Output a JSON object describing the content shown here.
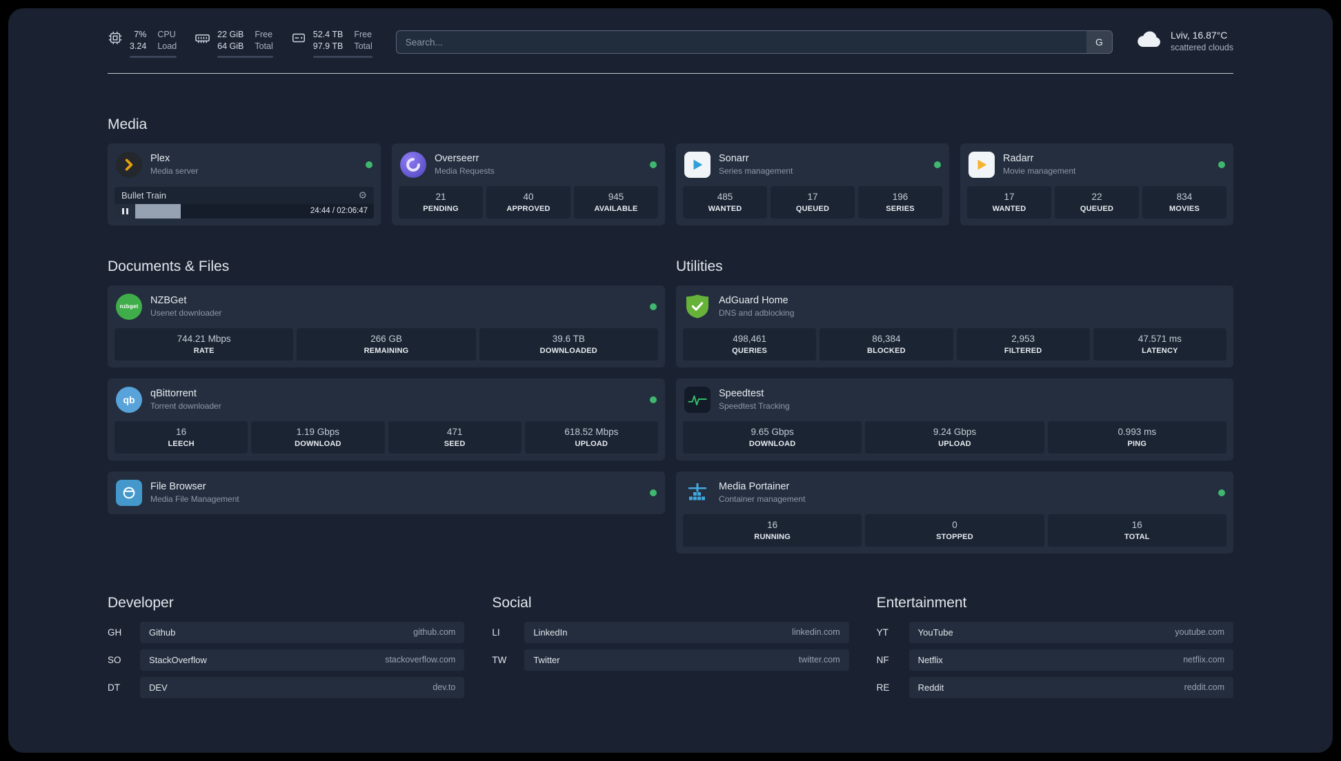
{
  "topbar": {
    "cpu": {
      "value1": "7%",
      "value2": "3.24",
      "label1": "CPU",
      "label2": "Load"
    },
    "ram": {
      "value1": "22 GiB",
      "value2": "64 GiB",
      "label1": "Free",
      "label2": "Total"
    },
    "disk": {
      "value1": "52.4 TB",
      "value2": "97.9 TB",
      "label1": "Free",
      "label2": "Total"
    },
    "search": {
      "placeholder": "Search...",
      "button_label": "G"
    },
    "weather": {
      "location": "Lviv, 16.87°C",
      "condition": "scattered clouds"
    }
  },
  "sections": {
    "media": "Media",
    "documents": "Documents & Files",
    "utilities": "Utilities",
    "developer": "Developer",
    "social": "Social",
    "entertainment": "Entertainment"
  },
  "apps": {
    "plex": {
      "title": "Plex",
      "subtitle": "Media server",
      "now_playing": "Bullet Train",
      "time": "24:44 / 02:06:47"
    },
    "overseerr": {
      "title": "Overseerr",
      "subtitle": "Media Requests",
      "stats": [
        {
          "value": "21",
          "label": "PENDING"
        },
        {
          "value": "40",
          "label": "APPROVED"
        },
        {
          "value": "945",
          "label": "AVAILABLE"
        }
      ]
    },
    "sonarr": {
      "title": "Sonarr",
      "subtitle": "Series management",
      "stats": [
        {
          "value": "485",
          "label": "WANTED"
        },
        {
          "value": "17",
          "label": "QUEUED"
        },
        {
          "value": "196",
          "label": "SERIES"
        }
      ]
    },
    "radarr": {
      "title": "Radarr",
      "subtitle": "Movie management",
      "stats": [
        {
          "value": "17",
          "label": "WANTED"
        },
        {
          "value": "22",
          "label": "QUEUED"
        },
        {
          "value": "834",
          "label": "MOVIES"
        }
      ]
    },
    "nzbget": {
      "title": "NZBGet",
      "subtitle": "Usenet downloader",
      "stats": [
        {
          "value": "744.21 Mbps",
          "label": "RATE"
        },
        {
          "value": "266 GB",
          "label": "REMAINING"
        },
        {
          "value": "39.6 TB",
          "label": "DOWNLOADED"
        }
      ]
    },
    "qbittorrent": {
      "title": "qBittorrent",
      "subtitle": "Torrent downloader",
      "stats": [
        {
          "value": "16",
          "label": "LEECH"
        },
        {
          "value": "1.19 Gbps",
          "label": "DOWNLOAD"
        },
        {
          "value": "471",
          "label": "SEED"
        },
        {
          "value": "618.52 Mbps",
          "label": "UPLOAD"
        }
      ]
    },
    "filebrowser": {
      "title": "File Browser",
      "subtitle": "Media File Management"
    },
    "adguard": {
      "title": "AdGuard Home",
      "subtitle": "DNS and adblocking",
      "stats": [
        {
          "value": "498,461",
          "label": "QUERIES"
        },
        {
          "value": "86,384",
          "label": "BLOCKED"
        },
        {
          "value": "2,953",
          "label": "FILTERED"
        },
        {
          "value": "47.571 ms",
          "label": "LATENCY"
        }
      ]
    },
    "speedtest": {
      "title": "Speedtest",
      "subtitle": "Speedtest Tracking",
      "stats": [
        {
          "value": "9.65 Gbps",
          "label": "DOWNLOAD"
        },
        {
          "value": "9.24 Gbps",
          "label": "UPLOAD"
        },
        {
          "value": "0.993 ms",
          "label": "PING"
        }
      ]
    },
    "portainer": {
      "title": "Media Portainer",
      "subtitle": "Container management",
      "stats": [
        {
          "value": "16",
          "label": "RUNNING"
        },
        {
          "value": "0",
          "label": "STOPPED"
        },
        {
          "value": "16",
          "label": "TOTAL"
        }
      ]
    }
  },
  "links": {
    "developer": [
      {
        "abbr": "GH",
        "name": "Github",
        "url": "github.com"
      },
      {
        "abbr": "SO",
        "name": "StackOverflow",
        "url": "stackoverflow.com"
      },
      {
        "abbr": "DT",
        "name": "DEV",
        "url": "dev.to"
      }
    ],
    "social": [
      {
        "abbr": "LI",
        "name": "LinkedIn",
        "url": "linkedin.com"
      },
      {
        "abbr": "TW",
        "name": "Twitter",
        "url": "twitter.com"
      }
    ],
    "entertainment": [
      {
        "abbr": "YT",
        "name": "YouTube",
        "url": "youtube.com"
      },
      {
        "abbr": "NF",
        "name": "Netflix",
        "url": "netflix.com"
      },
      {
        "abbr": "RE",
        "name": "Reddit",
        "url": "reddit.com"
      }
    ]
  },
  "colors": {
    "status_online": "#3fb76f",
    "accent_green": "#35c66b"
  }
}
